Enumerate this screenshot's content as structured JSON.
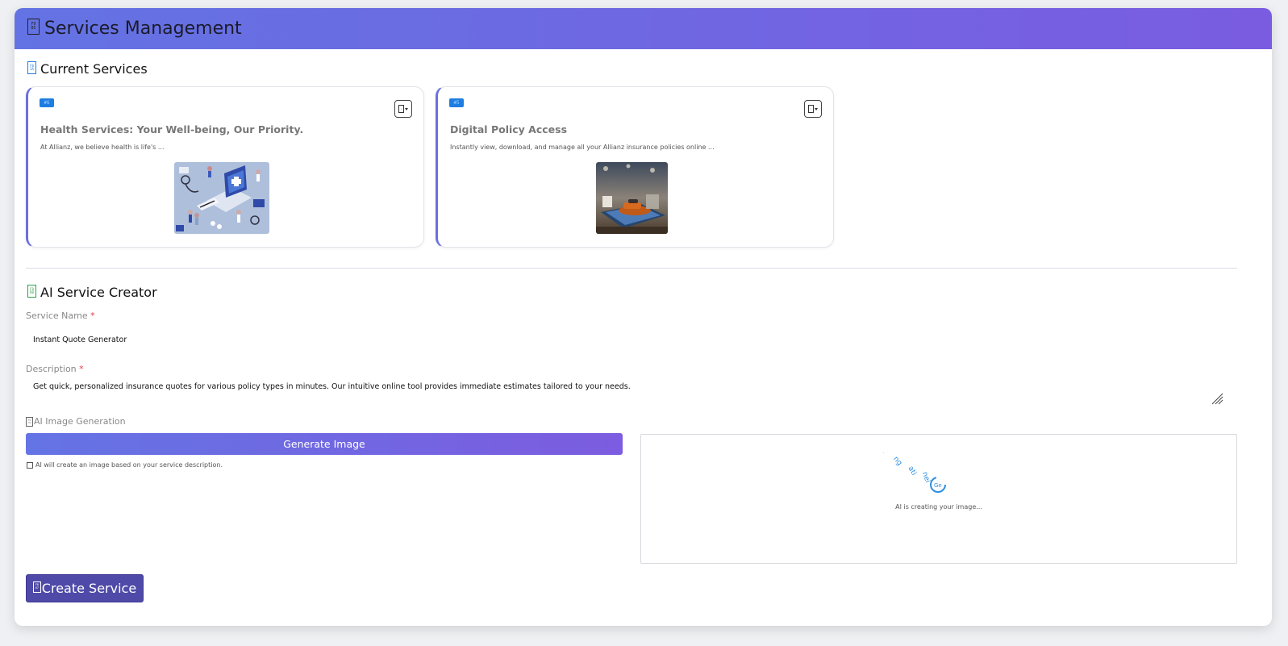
{
  "header": {
    "title": "Services Management",
    "icon": "services-icon"
  },
  "current_services": {
    "title": "Current Services",
    "icon": "list-icon",
    "cards": [
      {
        "badge": "#6",
        "title": "Health Services: Your Well-being, Our Priority.",
        "description": "At Allianz, we believe health is life's ...",
        "image": "health-illustration"
      },
      {
        "badge": "#5",
        "title": "Digital Policy Access",
        "description": "Instantly view, download, and manage all your Allianz insurance policies online ...",
        "image": "car-on-tablet-photo"
      }
    ]
  },
  "creator": {
    "title": "AI Service Creator",
    "icon": "robot-icon",
    "service_name_label": "Service Name",
    "required_mark": "*",
    "service_name_value": "Instant Quote Generator",
    "description_label": "Description",
    "description_value": "Get quick, personalized insurance quotes for various policy types in minutes. Our intuitive online tool provides immediate estimates tailored to your needs.",
    "image_generation_label": "AI Image Generation",
    "generate_button": "Generate Image",
    "hint": "AI will create an image based on your service description.",
    "preview_status": "AI is creating your image...",
    "create_button": "Create Service"
  },
  "colors": {
    "header_gradient_start": "#6373e3",
    "header_gradient_end": "#7a5ce1",
    "badge": "#1e7de0",
    "required": "#e0424a",
    "create_button": "#4f4aa8"
  }
}
